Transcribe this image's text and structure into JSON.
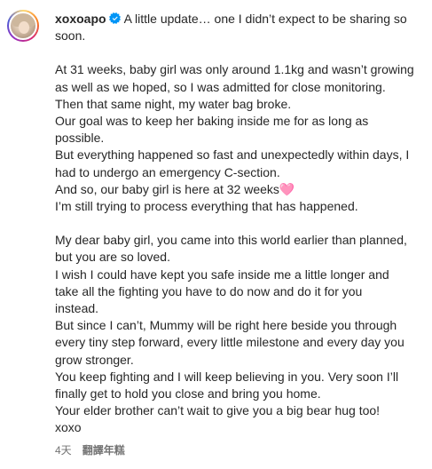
{
  "post": {
    "username": "xoxoapo",
    "verified_icon": "verified-badge-icon",
    "caption_lines": [
      [
        "A little update… one I didn’t expect to be sharing so",
        "soon."
      ],
      [
        "At 31 weeks, baby girl was only around 1.1kg and wasn’t growing",
        "as well as we hoped, so I was admitted for close monitoring.",
        "Then that same night, my water bag broke.",
        "Our goal was to keep her baking inside me for as long as",
        "possible.",
        "But everything happened so fast and unexpectedly within days, I",
        "had to undergo an emergency C-section.",
        "And so, our baby girl is here at 32 weeks🩷",
        "I’m still trying to process everything that has happened."
      ],
      [
        "My dear baby girl, you came into this world earlier than planned,",
        "but you are so loved.",
        "I wish I could have kept you safe inside me a little longer and",
        "take all the fighting you have to do now and do it for you",
        "instead.",
        "But since I can’t, Mummy will be right here beside you through",
        "every tiny step forward, every little milestone and every day you",
        "grow stronger.",
        "You keep fighting and I will keep believing in you. Very soon I’ll",
        "finally get to hold you close and bring you home.",
        "Your elder brother can’t wait to give you a big bear hug too!",
        "xoxo"
      ]
    ],
    "timestamp": "4天",
    "translate_label": "翻譯年糕",
    "colors": {
      "text": "#262626",
      "meta": "#737373",
      "verified": "#0095f6"
    }
  }
}
